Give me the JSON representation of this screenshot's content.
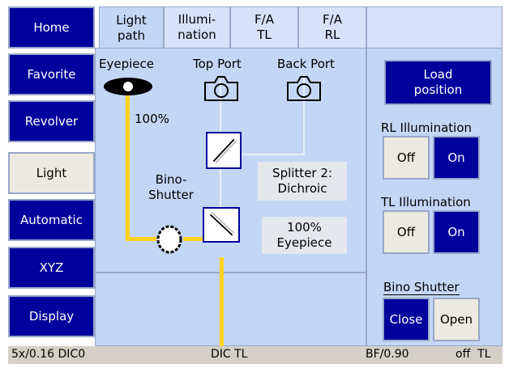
{
  "nav": {
    "items": [
      {
        "label": "Home",
        "active": false
      },
      {
        "label": "Favorite",
        "active": false
      },
      {
        "label": "Revolver",
        "active": false
      },
      {
        "label": "Light",
        "active": true
      },
      {
        "label": "Automatic",
        "active": false
      },
      {
        "label": "XYZ",
        "active": false
      },
      {
        "label": "Display",
        "active": false
      }
    ]
  },
  "tabs": [
    {
      "line1": "Light",
      "line2": "path",
      "active": true
    },
    {
      "line1": "Illumi-",
      "line2": "nation",
      "active": false
    },
    {
      "line1": "F/A",
      "line2": "TL",
      "active": false
    },
    {
      "line1": "F/A",
      "line2": "RL",
      "active": false
    }
  ],
  "lightpath": {
    "eyepiece_label": "Eyepiece",
    "eyepiece_percent": "100%",
    "top_port_label": "Top Port",
    "back_port_label": "Back Port",
    "bino_shutter_line1": "Bino-",
    "bino_shutter_line2": "Shutter",
    "splitter_line1": "Splitter 2:",
    "splitter_line2": "Dichroic",
    "output_line1": "100%",
    "output_line2": "Eyepiece"
  },
  "controls": {
    "load_position_line1": "Load",
    "load_position_line2": "position",
    "rl_illumination_label": "RL Illumination",
    "rl_off": "Off",
    "rl_on": "On",
    "rl_state": "On",
    "tl_illumination_label": "TL Illumination",
    "tl_off": "Off",
    "tl_on": "On",
    "tl_state": "On",
    "bino_shutter_label": "Bino Shutter",
    "bino_close": "Close",
    "bino_open": "Open",
    "bino_state": "Close"
  },
  "status": {
    "objective": "5x/0.16 DIC0",
    "contrast": "DIC TL",
    "condenser": "BF/0.90",
    "tl_state": "off  TL"
  },
  "colors": {
    "accent": "#00009c",
    "panel": "#c4d6f6",
    "light_path": "#ffd21e"
  }
}
